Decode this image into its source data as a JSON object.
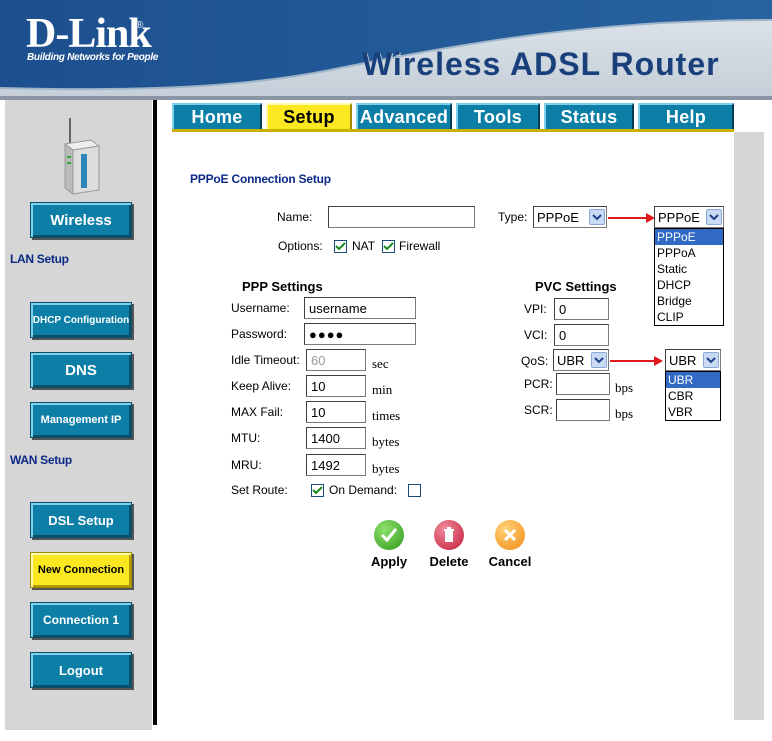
{
  "header": {
    "logo": "D-Link",
    "tagline": "Building Networks for People",
    "product": "Wireless ADSL Router"
  },
  "tabs": [
    {
      "label": "Home"
    },
    {
      "label": "Setup"
    },
    {
      "label": "Advanced"
    },
    {
      "label": "Tools"
    },
    {
      "label": "Status"
    },
    {
      "label": "Help"
    }
  ],
  "sidebar": {
    "wireless": "Wireless",
    "lan_setup": "LAN Setup",
    "dhcp": "DHCP Configuration",
    "dns": "DNS",
    "management_ip": "Management IP",
    "wan_setup": "WAN Setup",
    "dsl_setup": "DSL Setup",
    "new_connection": "New Connection",
    "connection1": "Connection 1",
    "logout": "Logout"
  },
  "form": {
    "heading": "PPPoE Connection Setup",
    "name_label": "Name:",
    "name_value": "",
    "type_label": "Type:",
    "type_value": "PPPoE",
    "type_options": [
      "PPPoE",
      "PPPoA",
      "Static",
      "DHCP",
      "Bridge",
      "CLIP"
    ],
    "options_label": "Options:",
    "nat_label": "NAT",
    "firewall_label": "Firewall",
    "ppp_title": "PPP Settings",
    "username_label": "Username:",
    "username_value": "username",
    "password_label": "Password:",
    "password_value": "●●●●",
    "idle_label": "Idle Timeout:",
    "idle_value": "60",
    "idle_unit": "sec",
    "keepalive_label": "Keep Alive:",
    "keepalive_value": "10",
    "keepalive_unit": "min",
    "maxfail_label": "MAX Fail:",
    "maxfail_value": "10",
    "maxfail_unit": "times",
    "mtu_label": "MTU:",
    "mtu_value": "1400",
    "mtu_unit": "bytes",
    "mru_label": "MRU:",
    "mru_value": "1492",
    "mru_unit": "bytes",
    "setroute_label": "Set Route:",
    "ondemand_label": "On Demand:",
    "pvc_title": "PVC Settings",
    "vpi_label": "VPI:",
    "vpi_value": "0",
    "vci_label": "VCI:",
    "vci_value": "0",
    "qos_label": "QoS:",
    "qos_value": "UBR",
    "qos_options": [
      "UBR",
      "CBR",
      "VBR"
    ],
    "pcr_label": "PCR:",
    "pcr_unit": "bps",
    "scr_label": "SCR:",
    "scr_unit": "bps"
  },
  "actions": {
    "apply": "Apply",
    "delete": "Delete",
    "cancel": "Cancel"
  },
  "colors": {
    "brand_blue": "#19407a",
    "button_teal": "#0d7fa6",
    "active_yellow": "#fce821",
    "label_navy": "#0b2a86",
    "arrow_red": "#e0191f"
  }
}
